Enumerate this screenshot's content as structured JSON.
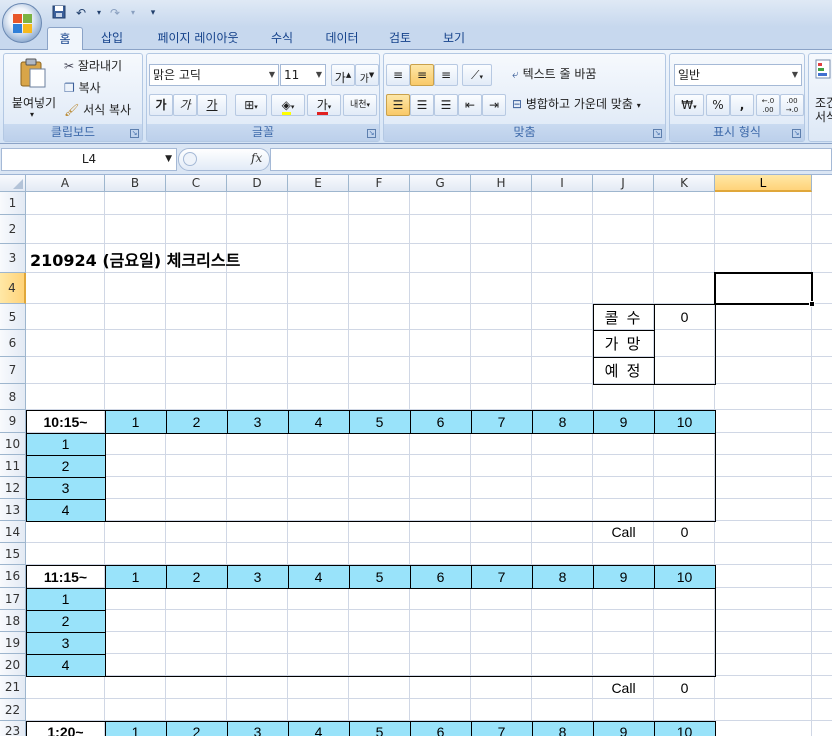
{
  "qat": {
    "office_button_label": "Office",
    "save_icon": "save-icon",
    "undo_icon": "undo-icon",
    "redo_icon": "redo-icon",
    "customize_icon": "customize-qat-icon"
  },
  "tabs": [
    "홈",
    "삽입",
    "페이지 레이아웃",
    "수식",
    "데이터",
    "검토",
    "보기"
  ],
  "ribbon": {
    "clipboard": {
      "paste": "붙여넣기",
      "cut": "잘라내기",
      "copy": "복사",
      "format_painter": "서식 복사",
      "label": "클립보드"
    },
    "font": {
      "name": "맑은 고딕",
      "size": "11",
      "grow": "가",
      "shrink": "가",
      "bold": "가",
      "italic": "가",
      "underline": "가",
      "font_color": "가",
      "phonetic": "내천",
      "label": "글꼴"
    },
    "alignment": {
      "wrap_text": "텍스트 줄 바꿈",
      "merge_center": "병합하고 가운데 맞춤",
      "label": "맞춤"
    },
    "number": {
      "format": "일반",
      "currency": "₩",
      "percent": "%",
      "comma": ",",
      "inc_decimal": "←.0 .00",
      "dec_decimal": ".00 →.0",
      "label": "표시 형식"
    },
    "styles": {
      "label1": "조건",
      "label2": "서식"
    }
  },
  "formula_bar": {
    "name_box": "L4",
    "fx": "fx",
    "formula": ""
  },
  "columns": [
    "A",
    "B",
    "C",
    "D",
    "E",
    "F",
    "G",
    "H",
    "I",
    "J",
    "K",
    "L"
  ],
  "selected_column": "L",
  "rows": [
    "1",
    "2",
    "3",
    "4",
    "5",
    "6",
    "7",
    "8",
    "9",
    "10",
    "11",
    "12",
    "13",
    "14",
    "15",
    "16",
    "17",
    "18",
    "19",
    "20",
    "21",
    "22",
    "23"
  ],
  "selected_row": "4",
  "sheet": {
    "title": "210924 (금요일)  체크리스트",
    "summary": [
      {
        "label": "콜 수",
        "value": "0"
      },
      {
        "label": "가 망",
        "value": ""
      },
      {
        "label": "예 정",
        "value": ""
      }
    ],
    "blocks": [
      {
        "time": "10:15~",
        "numbers": [
          "1",
          "2",
          "3",
          "4",
          "5",
          "6",
          "7",
          "8",
          "9",
          "10"
        ],
        "items": [
          "1",
          "2",
          "3",
          "4"
        ],
        "call_label": "Call",
        "call_value": "0"
      },
      {
        "time": "11:15~",
        "numbers": [
          "1",
          "2",
          "3",
          "4",
          "5",
          "6",
          "7",
          "8",
          "9",
          "10"
        ],
        "items": [
          "1",
          "2",
          "3",
          "4"
        ],
        "call_label": "Call",
        "call_value": "0"
      },
      {
        "time": "1:20~",
        "numbers": [
          "1",
          "2",
          "3",
          "4",
          "5",
          "6",
          "7",
          "8",
          "9",
          "10"
        ]
      }
    ]
  },
  "colors": {
    "header_fill": "#99e3fa",
    "selection_border": "#000000",
    "ribbon_text": "#15428b"
  }
}
